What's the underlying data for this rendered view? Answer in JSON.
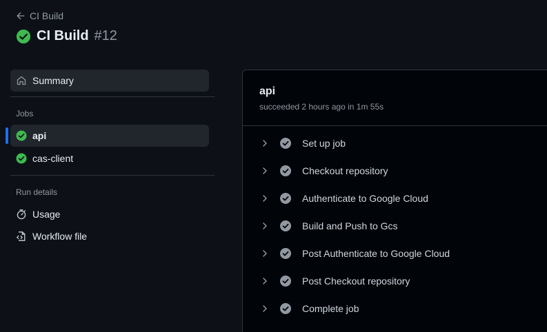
{
  "header": {
    "back_label": "CI Build",
    "title": "CI Build",
    "run_number": "#12"
  },
  "sidebar": {
    "summary_label": "Summary",
    "jobs_heading": "Jobs",
    "jobs": [
      {
        "label": "api",
        "selected": true
      },
      {
        "label": "cas-client",
        "selected": false
      }
    ],
    "run_details_heading": "Run details",
    "details": [
      {
        "label": "Usage",
        "icon": "stopwatch-icon"
      },
      {
        "label": "Workflow file",
        "icon": "file-code-icon"
      }
    ]
  },
  "job": {
    "name": "api",
    "meta": "succeeded 2 hours ago in 1m 55s",
    "steps": [
      {
        "label": "Set up job"
      },
      {
        "label": "Checkout repository"
      },
      {
        "label": "Authenticate to Google Cloud"
      },
      {
        "label": "Build and Push to Gcs"
      },
      {
        "label": "Post Authenticate to Google Cloud"
      },
      {
        "label": "Post Checkout repository"
      },
      {
        "label": "Complete job"
      }
    ]
  },
  "colors": {
    "background": "#0d1117",
    "success": "#3fb950",
    "step_check": "#9198a1",
    "accent": "#1f6feb"
  }
}
